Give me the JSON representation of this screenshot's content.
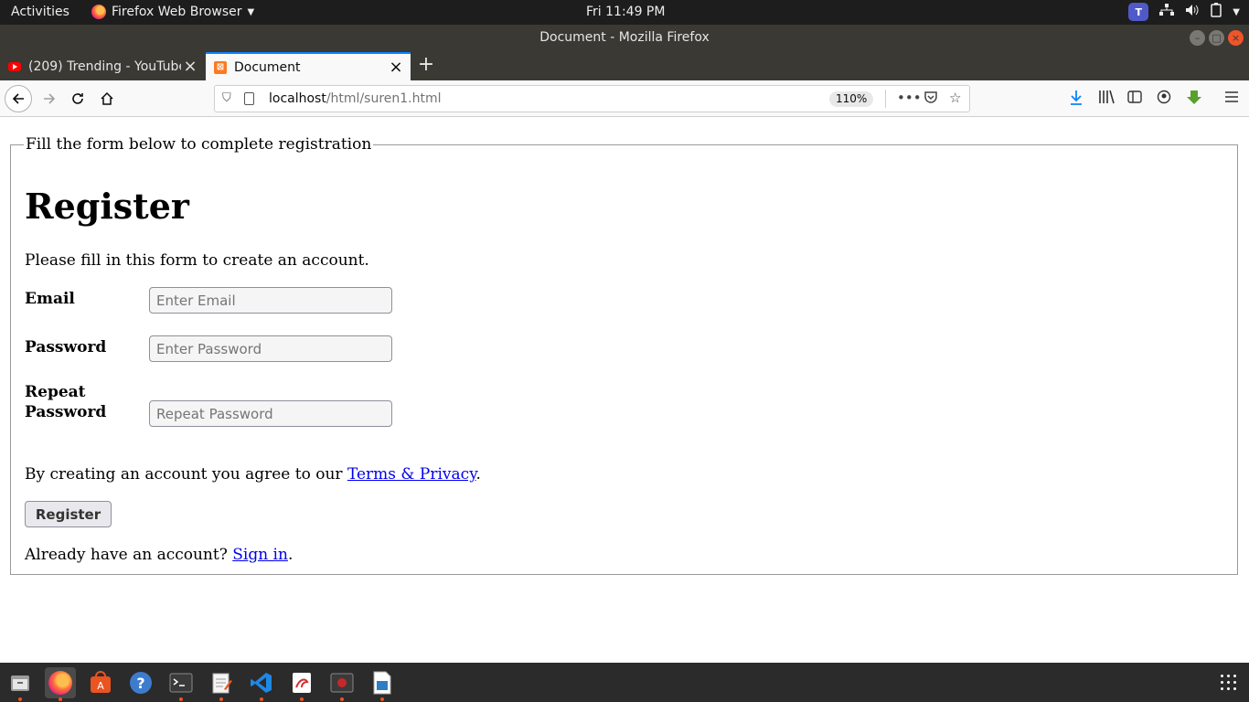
{
  "topbar": {
    "activities": "Activities",
    "app_menu": "Firefox Web Browser",
    "clock": "Fri 11:49 PM",
    "teams_letter": "T"
  },
  "window": {
    "title": "Document - Mozilla Firefox"
  },
  "tabs": [
    {
      "label": "(209) Trending - YouTube",
      "icon": "youtube-icon",
      "active": false
    },
    {
      "label": "Document",
      "icon": "xampp-icon",
      "active": true
    }
  ],
  "navbar": {
    "url_host": "localhost",
    "url_path": "/html/suren1.html",
    "zoom": "110%"
  },
  "page": {
    "legend": "Fill the form below to complete registration",
    "heading": "Register",
    "intro": "Please fill in this form to create an account.",
    "fields": [
      {
        "label": "Email",
        "placeholder": "Enter Email",
        "value": ""
      },
      {
        "label": "Password",
        "placeholder": "Enter Password",
        "value": ""
      },
      {
        "label_line1": "Repeat",
        "label_line2": "Password",
        "placeholder": "Repeat Password",
        "value": ""
      }
    ],
    "agree_prefix": "By creating an account you agree to our ",
    "agree_link": "Terms & Privacy",
    "agree_suffix": ".",
    "register_button": "Register",
    "signin_prefix": "Already have an account? ",
    "signin_link": "Sign in",
    "signin_suffix": "."
  },
  "dock": {
    "apps": [
      "files-icon",
      "firefox-icon",
      "software-center-icon",
      "help-icon",
      "terminal-icon",
      "text-editor-icon",
      "vscode-icon",
      "app-icon",
      "screen-recorder-icon",
      "libreoffice-draw-icon"
    ],
    "accent": "#e95420"
  }
}
